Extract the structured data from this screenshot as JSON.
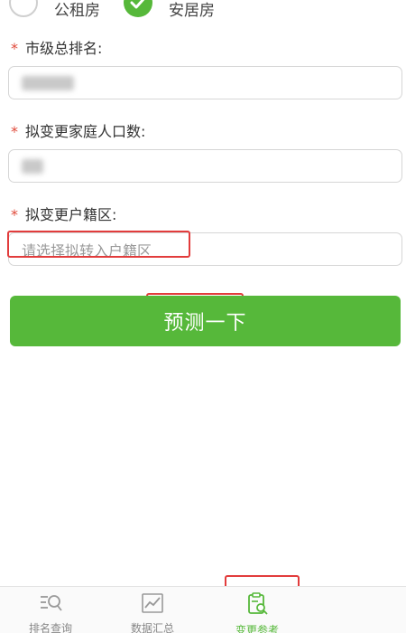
{
  "housing_type": {
    "options": [
      {
        "label": "公租房",
        "checked": false
      },
      {
        "label": "安居房",
        "checked": true
      }
    ]
  },
  "form": {
    "rank": {
      "label": "市级总排名:",
      "required_mark": "*"
    },
    "family_size": {
      "label": "拟变更家庭人口数:",
      "required_mark": "*"
    },
    "district": {
      "label": "拟变更户籍区:",
      "required_mark": "*",
      "placeholder": "请选择拟转入户籍区"
    }
  },
  "predict_button": {
    "label": "预测一下"
  },
  "tabbar": {
    "tabs": [
      {
        "label": "排名查询",
        "icon": "search-list-icon",
        "active": false
      },
      {
        "label": "数据汇总",
        "icon": "chart-trend-icon",
        "active": false
      },
      {
        "label": "变更参考",
        "icon": "clipboard-search-icon",
        "active": true
      }
    ]
  },
  "colors": {
    "accent": "#56b83a",
    "required": "#e04a3a",
    "highlight": "#e23c3c"
  }
}
